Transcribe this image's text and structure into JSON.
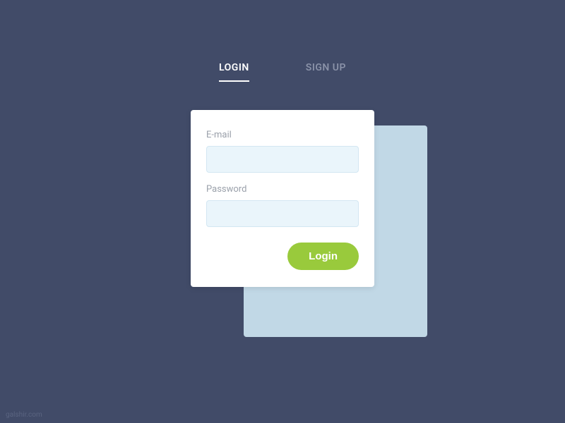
{
  "tabs": {
    "login": "LOGIN",
    "signup": "SIGN UP"
  },
  "form": {
    "email_label": "E-mail",
    "password_label": "Password",
    "email_value": "",
    "password_value": "",
    "submit_label": "Login"
  },
  "footer": {
    "credit": "galshir.com"
  }
}
